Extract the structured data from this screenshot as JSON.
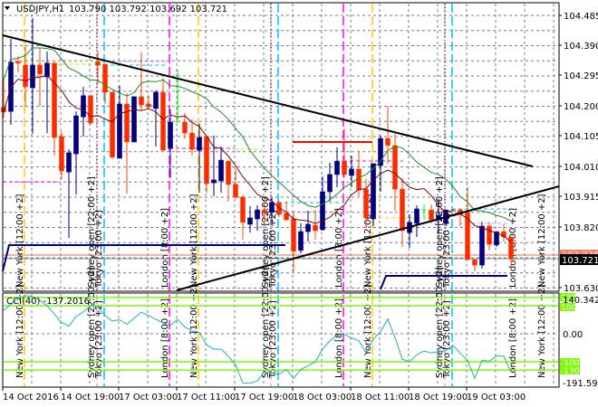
{
  "header": {
    "symbol": "USDJPY,H1",
    "ohlc": "103.790 103.792 103.692 103.721"
  },
  "price_axis": [
    "104.485",
    "104.390",
    "104.295",
    "104.200",
    "104.105",
    "104.010",
    "103.915",
    "103.820",
    "103.630"
  ],
  "price_badges": {
    "level": "103.735",
    "last": "103.721"
  },
  "time_axis": [
    "14 Oct 2016",
    "14 Oct 19:00",
    "17 Oct 03:00",
    "17 Oct 11:00",
    "17 Oct 19:00",
    "18 Oct 03:00",
    "18 Oct 11:00",
    "18 Oct 19:00",
    "19 Oct 03:00"
  ],
  "sessions": {
    "new_york": "New York  [12:00  +2]",
    "sydney": "Sydney open  [22:00  +2]",
    "tokyo": "Tokyo  [23:00  +2]",
    "london": "London  [8:00  +2]"
  },
  "cci": {
    "title": "CCI(40) -137.2016",
    "max_label": "140.3424",
    "zero_label": "0.00",
    "min_label": "-191.5962",
    "levels": [
      "130",
      "100",
      "-100",
      "-130"
    ]
  },
  "colors": {
    "bull": "#000080",
    "bear": "#ff2a00",
    "bear_wick": "#ff4500",
    "doji": "#00ff00",
    "ma_fast": "#800000",
    "ma_slow": "#228b22",
    "cci_line": "#20b2aa",
    "cci_level": "#7cfc00",
    "new_york": "#ffcc00",
    "london": "#ff00ff",
    "sydney": "#dda0dd",
    "tokyo": "#00bfff"
  },
  "chart_data": {
    "type": "candlestick",
    "title": "USDJPY,H1",
    "timeframe": "H1",
    "ylim": [
      103.63,
      104.485
    ],
    "x_tick_labels": [
      "14 Oct 2016",
      "14 Oct 19:00",
      "17 Oct 03:00",
      "17 Oct 11:00",
      "17 Oct 19:00",
      "18 Oct 03:00",
      "18 Oct 11:00",
      "18 Oct 19:00",
      "19 Oct 03:00"
    ],
    "ohlc_fields": [
      "open",
      "high",
      "low",
      "close"
    ],
    "candles": [
      [
        104.196,
        104.284,
        104.165,
        104.182
      ],
      [
        104.184,
        104.411,
        104.142,
        104.338
      ],
      [
        104.34,
        104.357,
        104.306,
        104.335
      ],
      [
        104.329,
        104.386,
        104.201,
        104.261
      ],
      [
        104.258,
        104.476,
        104.114,
        104.329
      ],
      [
        104.329,
        104.383,
        104.201,
        104.301
      ],
      [
        104.292,
        104.372,
        104.116,
        104.335
      ],
      [
        104.335,
        104.34,
        104.045,
        104.102
      ],
      [
        104.105,
        104.122,
        103.972,
        103.997
      ],
      [
        103.994,
        104.065,
        103.787,
        104.054
      ],
      [
        104.051,
        104.184,
        103.923,
        104.17
      ],
      [
        104.167,
        104.261,
        104.105,
        104.233
      ],
      [
        104.233,
        104.235,
        104.142,
        104.148
      ],
      [
        104.34,
        104.372,
        104.272,
        104.329
      ],
      [
        104.332,
        104.332,
        104.207,
        104.244
      ],
      [
        104.244,
        104.244,
        104.037,
        104.04
      ],
      [
        104.037,
        104.264,
        104.037,
        104.207
      ],
      [
        104.207,
        104.241,
        103.926,
        104.088
      ],
      [
        104.088,
        104.23,
        104.088,
        104.23
      ],
      [
        104.23,
        104.369,
        104.187,
        104.204
      ],
      [
        104.207,
        104.235,
        104.193,
        104.199
      ],
      [
        104.193,
        104.25,
        104.074,
        104.244
      ],
      [
        104.244,
        104.289,
        104.062,
        104.062
      ],
      [
        104.068,
        104.19,
        103.975,
        104.15
      ],
      [
        104.153,
        104.315,
        104.148,
        104.153
      ],
      [
        104.15,
        104.179,
        104.099,
        104.116
      ],
      [
        104.116,
        104.159,
        104.045,
        104.065
      ],
      [
        104.062,
        104.145,
        103.929,
        104.102
      ],
      [
        104.105,
        104.105,
        103.929,
        103.958
      ],
      [
        103.96,
        104.108,
        103.918,
        103.969
      ],
      [
        103.966,
        104.074,
        103.929,
        104.031
      ],
      [
        104.028,
        104.028,
        103.901,
        103.955
      ],
      [
        103.955,
        104.003,
        103.909,
        103.915
      ],
      [
        103.915,
        103.923,
        103.782,
        103.836
      ],
      [
        103.83,
        103.887,
        103.804,
        103.85
      ],
      [
        103.847,
        103.889,
        103.81,
        103.875
      ],
      [
        103.875,
        103.892,
        103.824,
        103.864
      ],
      [
        103.867,
        103.915,
        103.838,
        103.898
      ],
      [
        103.898,
        103.904,
        103.853,
        103.861
      ],
      [
        103.864,
        103.901,
        103.841,
        103.844
      ],
      [
        103.847,
        103.867,
        103.682,
        103.745
      ],
      [
        103.748,
        103.833,
        103.739,
        103.807
      ],
      [
        103.807,
        103.872,
        103.776,
        103.83
      ],
      [
        103.827,
        103.875,
        103.782,
        103.81
      ],
      [
        103.813,
        103.98,
        103.81,
        103.932
      ],
      [
        103.932,
        104.023,
        103.901,
        103.986
      ],
      [
        103.986,
        104.071,
        103.946,
        104.028
      ],
      [
        104.028,
        104.131,
        103.975,
        103.986
      ],
      [
        103.983,
        104.045,
        103.946,
        104.003
      ],
      [
        104.003,
        104.06,
        103.918,
        103.938
      ],
      [
        103.94,
        103.972,
        103.819,
        103.85
      ],
      [
        103.847,
        104.02,
        103.824,
        104.02
      ],
      [
        104.014,
        104.108,
        103.932,
        104.099
      ],
      [
        104.099,
        104.201,
        104.02,
        104.077
      ],
      [
        104.077,
        104.114,
        103.872,
        103.94
      ],
      [
        103.94,
        103.975,
        103.759,
        103.81
      ],
      [
        103.804,
        103.861,
        103.756,
        103.836
      ],
      [
        103.833,
        103.889,
        103.79,
        103.878
      ],
      [
        103.875,
        103.892,
        103.847,
        103.875
      ],
      [
        103.875,
        103.892,
        103.833,
        103.844
      ],
      [
        103.844,
        103.909,
        103.804,
        103.858
      ],
      [
        103.833,
        103.875,
        103.83,
        103.875
      ],
      [
        103.875,
        103.878,
        103.87,
        103.872
      ],
      [
        103.875,
        103.878,
        103.824,
        103.861
      ],
      [
        103.867,
        103.946,
        103.719,
        103.719
      ],
      [
        103.719,
        103.719,
        103.682,
        103.702
      ],
      [
        103.702,
        103.838,
        103.691,
        103.824
      ],
      [
        103.824,
        103.838,
        103.748,
        103.767
      ],
      [
        103.765,
        103.807,
        103.759,
        103.807
      ],
      [
        103.807,
        103.83,
        103.776,
        103.79
      ],
      [
        103.79,
        103.792,
        103.692,
        103.721
      ]
    ],
    "cci_period": 40,
    "cci_values": [
      83,
      105,
      125,
      136,
      132,
      120,
      100,
      70,
      40,
      27,
      61,
      78,
      100,
      95,
      65,
      45,
      50,
      34,
      55,
      77,
      65,
      52,
      38,
      30,
      51,
      24,
      10,
      5,
      -40,
      -55,
      -55,
      -80,
      -111,
      -175,
      -177,
      -168,
      -135,
      -140,
      -145,
      -127,
      -159,
      -127,
      -115,
      -100,
      -55,
      -25,
      -5,
      -3,
      -15,
      -25,
      -68,
      -19,
      7,
      53,
      -14,
      -91,
      -100,
      -75,
      -62,
      -68,
      -64,
      -60,
      -41,
      -70,
      -95,
      -159,
      -95,
      -98,
      -80,
      -80,
      -137.2016
    ],
    "cci_levels": [
      130,
      100,
      -100,
      -130
    ],
    "cci_range": [
      -191.5962,
      140.3424
    ]
  }
}
